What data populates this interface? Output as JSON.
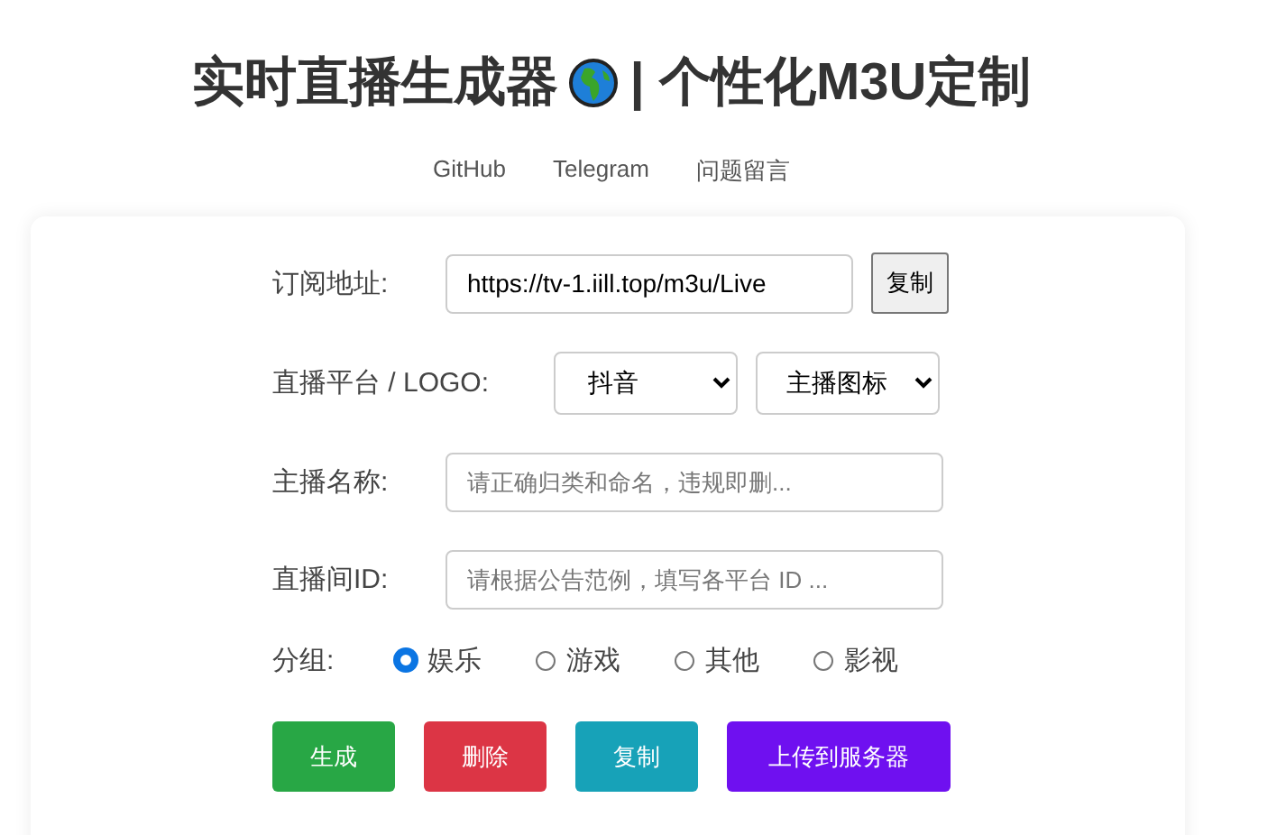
{
  "header": {
    "title_left": "实时直播生成器",
    "title_right": "| 个性化M3U定制",
    "links": [
      "GitHub",
      "Telegram",
      "问题留言"
    ]
  },
  "form": {
    "subscription": {
      "label": "订阅地址:",
      "value": "https://tv-1.iill.top/m3u/Live",
      "button": "复制"
    },
    "platform": {
      "label": "直播平台 / LOGO:",
      "platform_value": "抖音",
      "logo_value": "主播图标"
    },
    "streamer_name": {
      "label": "主播名称:",
      "placeholder": "请正确归类和命名，违规即删..."
    },
    "room_id": {
      "label": "直播间ID:",
      "placeholder": "请根据公告范例，填写各平台 ID ..."
    },
    "group": {
      "label": "分组:",
      "options": [
        {
          "label": "娱乐",
          "selected": true
        },
        {
          "label": "游戏",
          "selected": false
        },
        {
          "label": "其他",
          "selected": false
        },
        {
          "label": "影视",
          "selected": false
        }
      ]
    },
    "actions": [
      {
        "label": "生成",
        "kind": "generate"
      },
      {
        "label": "删除",
        "kind": "delete"
      },
      {
        "label": "复制",
        "kind": "copy"
      },
      {
        "label": "上传到服务器",
        "kind": "upload"
      }
    ]
  }
}
